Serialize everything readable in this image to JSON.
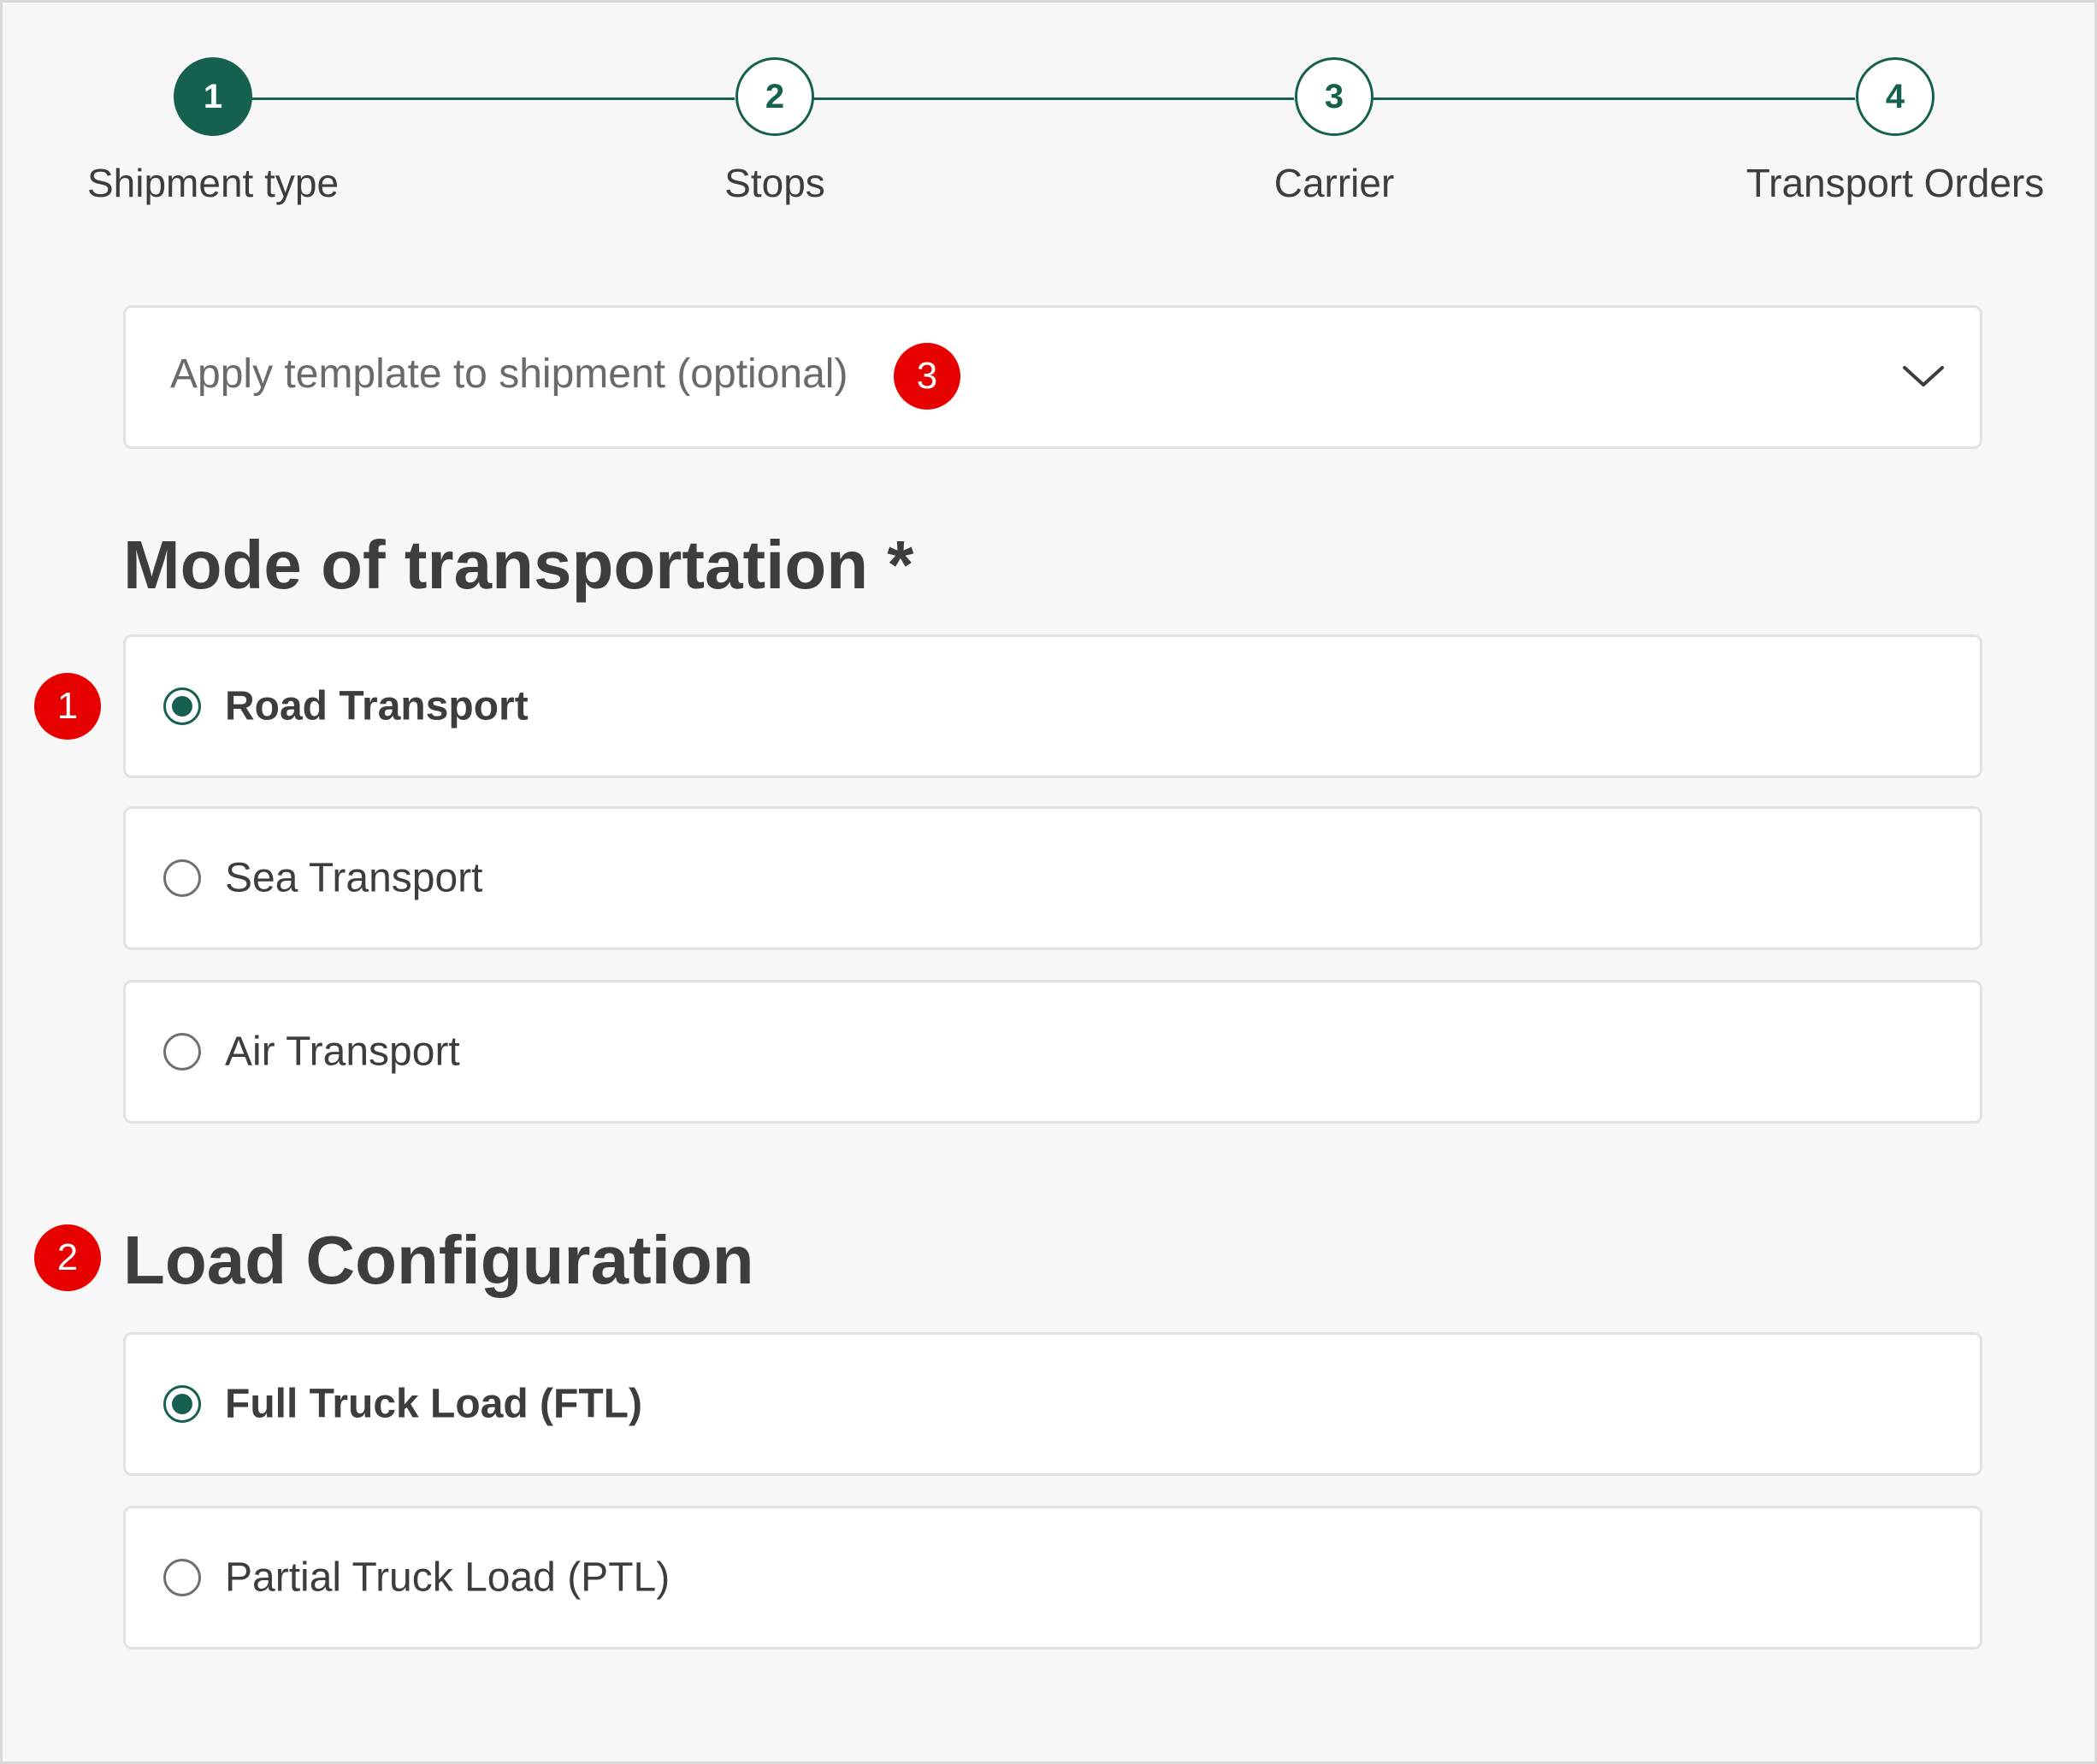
{
  "stepper": {
    "steps": [
      {
        "number": "1",
        "label": "Shipment type",
        "active": true
      },
      {
        "number": "2",
        "label": "Stops",
        "active": false
      },
      {
        "number": "3",
        "label": "Carrier",
        "active": false
      },
      {
        "number": "4",
        "label": "Transport Orders",
        "active": false
      }
    ]
  },
  "template": {
    "placeholder": "Apply template to shipment (optional)",
    "icon": "chevron-down-icon"
  },
  "mode_of_transportation": {
    "heading": "Mode of transportation *",
    "options": [
      {
        "label": "Road Transport",
        "selected": true
      },
      {
        "label": "Sea Transport",
        "selected": false
      },
      {
        "label": "Air Transport",
        "selected": false
      }
    ]
  },
  "load_configuration": {
    "heading": "Load Configuration",
    "options": [
      {
        "label": "Full Truck Load (FTL)",
        "selected": true
      },
      {
        "label": "Partial Truck Load (PTL)",
        "selected": false
      }
    ]
  },
  "callouts": [
    "1",
    "2",
    "3"
  ],
  "colors": {
    "primary": "#16604f",
    "callout": "#e60000",
    "background": "#f7f7f7",
    "border": "#dfe3e8"
  }
}
